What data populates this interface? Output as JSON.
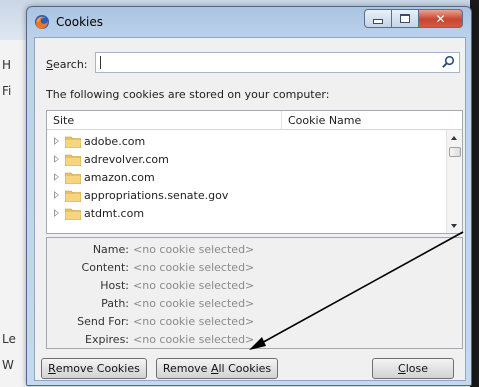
{
  "background": {
    "sidebar_letters": [
      "H",
      "Fi",
      "Le",
      "W"
    ]
  },
  "window": {
    "title": "Cookies",
    "app_icon": "firefox-icon",
    "controls": {
      "minimize_icon": "minimize-icon",
      "maximize_icon": "maximize-icon",
      "close_icon": "close-icon"
    }
  },
  "search": {
    "label_underlined": "S",
    "label_rest": "earch:",
    "value": "",
    "icon": "search-icon"
  },
  "info_text": "The following cookies are stored on your computer:",
  "tree": {
    "columns": {
      "site": "Site",
      "cookie_name": "Cookie Name"
    },
    "rows": [
      {
        "site": "adobe.com"
      },
      {
        "site": "adrevolver.com"
      },
      {
        "site": "amazon.com"
      },
      {
        "site": "appropriations.senate.gov"
      },
      {
        "site": "atdmt.com"
      }
    ]
  },
  "details": {
    "fields": [
      {
        "label": "Name:",
        "value": "<no cookie selected>"
      },
      {
        "label": "Content:",
        "value": "<no cookie selected>"
      },
      {
        "label": "Host:",
        "value": "<no cookie selected>"
      },
      {
        "label": "Path:",
        "value": "<no cookie selected>"
      },
      {
        "label": "Send For:",
        "value": "<no cookie selected>"
      },
      {
        "label": "Expires:",
        "value": "<no cookie selected>"
      }
    ]
  },
  "buttons": {
    "remove_cookies": {
      "underlined": "R",
      "rest": "emove Cookies"
    },
    "remove_all": {
      "before": "Remove ",
      "underlined": "A",
      "rest": "ll Cookies"
    },
    "close": {
      "underlined": "C",
      "rest": "lose"
    }
  },
  "colors": {
    "titlebar": "#bcd2ea",
    "close_button": "#c7462f",
    "annotation_arrow": "#000000"
  }
}
